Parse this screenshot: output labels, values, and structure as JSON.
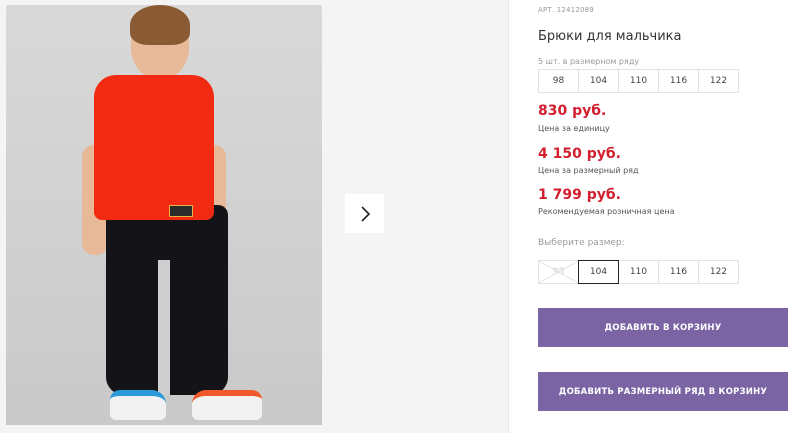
{
  "gallery": {
    "next_icon": "chevron-right-icon"
  },
  "product": {
    "article": "АРТ. 12412089",
    "title": "Брюки для мальчика",
    "series_caption": "5 шт. в размерном ряду",
    "series_sizes": [
      "98",
      "104",
      "110",
      "116",
      "122"
    ]
  },
  "prices": {
    "unit_price": "830 руб.",
    "unit_note": "Цена за единицу",
    "series_price": "4 150 руб.",
    "series_note": "Цена за размерный ряд",
    "retail_price": "1 799 руб.",
    "retail_note": "Рекомендуемая розничная цена"
  },
  "size_select": {
    "caption": "Выберите размер:",
    "options": [
      "98",
      "104",
      "110",
      "116",
      "122"
    ],
    "selected": "104",
    "unavailable": [
      "98"
    ]
  },
  "actions": {
    "add_to_cart": "ДОБАВИТЬ В КОРЗИНУ",
    "add_series_to_cart": "ДОБАВИТЬ РАЗМЕРНЫЙ РЯД В КОРЗИНУ"
  },
  "colors": {
    "price_red": "#d21e2d",
    "button_purple": "#7a64a4"
  }
}
